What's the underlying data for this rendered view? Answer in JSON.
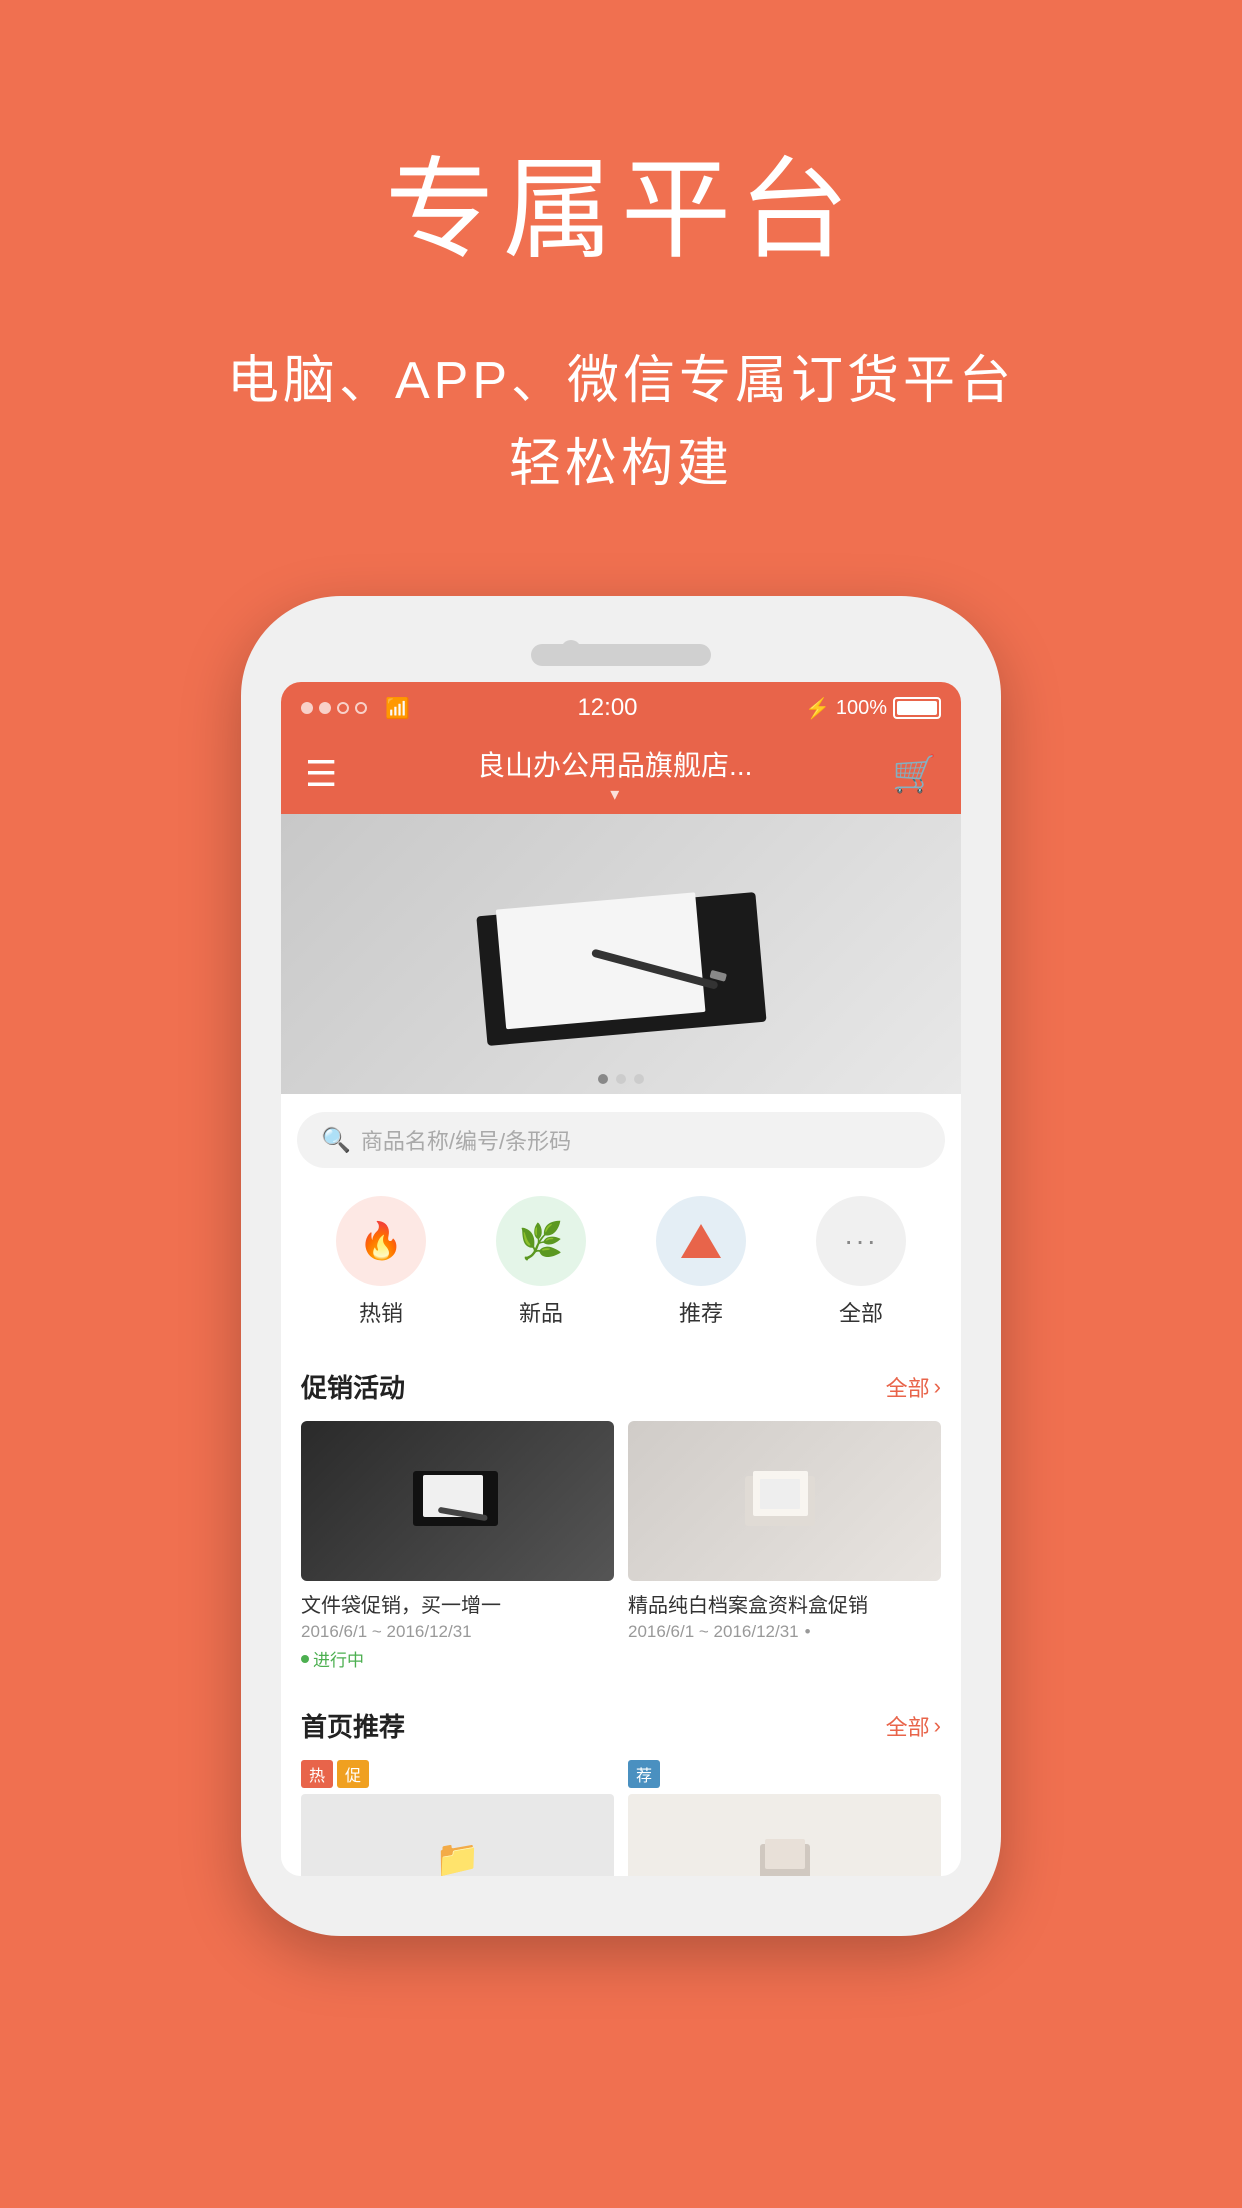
{
  "page": {
    "bg_color": "#F07050"
  },
  "hero": {
    "title": "专属平台",
    "subtitle_line1": "电脑、APP、微信专属订货平台",
    "subtitle_line2": "轻松构建"
  },
  "phone": {
    "status_bar": {
      "time": "12:00",
      "battery": "100%"
    },
    "nav": {
      "title": "良山办公用品旗舰店...",
      "subtitle": "▾"
    },
    "search": {
      "placeholder": "商品名称/编号/条形码"
    },
    "categories": [
      {
        "label": "热销",
        "type": "hot"
      },
      {
        "label": "新品",
        "type": "new"
      },
      {
        "label": "推荐",
        "type": "rec"
      },
      {
        "label": "全部",
        "type": "all"
      }
    ],
    "promo_section": {
      "title": "促销活动",
      "more": "全部",
      "items": [
        {
          "name": "文件袋促销，买一增一",
          "date": "2016/6/1 ~ 2016/12/31",
          "status": "进行中"
        },
        {
          "name": "精品纯白档案盒资料盒促销",
          "date": "2016/6/1 ~ 2016/12/31",
          "status": ""
        }
      ]
    },
    "recommend_section": {
      "title": "首页推荐",
      "more": "全部"
    }
  }
}
